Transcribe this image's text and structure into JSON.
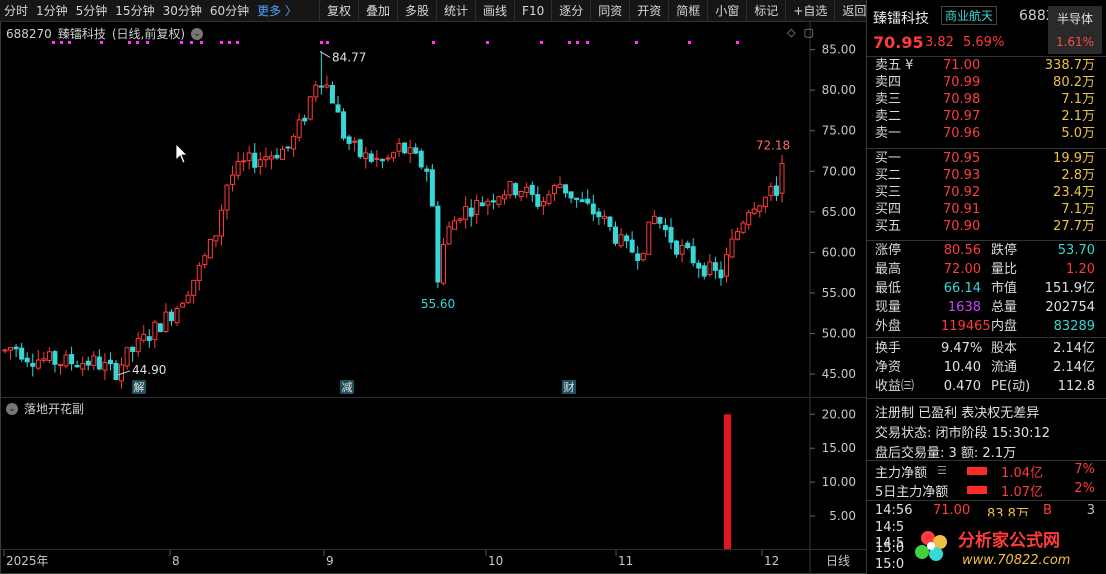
{
  "toolbar": {
    "periods": [
      "分时",
      "1分钟",
      "5分钟",
      "15分钟",
      "30分钟",
      "60分钟"
    ],
    "more": "更多 〉",
    "buttons": [
      "复权",
      "叠加",
      "多股",
      "统计",
      "画线",
      "F10",
      "逐分",
      "同资",
      "开资",
      "简框",
      "小窗",
      "标记",
      "+自选",
      "返回"
    ]
  },
  "chart": {
    "title_code": "688270",
    "title_name": "臻镭科技",
    "title_mode": "(日线,前复权)",
    "sub_title": "落地开花副",
    "period_label": "日线",
    "colors": {
      "up": "#ff3b3b",
      "down": "#35d7d7",
      "grid": "#2a2a2a",
      "dot": "#ff33ff",
      "bar": "#e8141c"
    }
  },
  "chart_data": {
    "type": "candlestick",
    "price_axis": {
      "ticks": [
        85.0,
        80.0,
        75.0,
        70.0,
        65.0,
        60.0,
        55.0,
        50.0,
        45.0
      ],
      "ylim": [
        42.3,
        88.4
      ]
    },
    "indicator_axis": {
      "ticks": [
        20.0,
        15.0,
        10.0,
        5.0
      ],
      "ylim": [
        0,
        22.4
      ]
    },
    "time_axis": {
      "labels": [
        "2025年",
        "8",
        "9",
        "10",
        "11",
        "12"
      ]
    },
    "annotations": {
      "high": "84.77",
      "low": "44.90",
      "low2": "55.60",
      "recent_high": "72.18"
    },
    "events": [
      "解",
      "减",
      "财"
    ],
    "indicator_spike": 20.0
  },
  "panel": {
    "name": "臻镭科技",
    "tag": "商业航天",
    "code": "688270",
    "sector_name": "半导体",
    "sector_pct": "1.61%",
    "price": "70.95",
    "change": "3.82",
    "change_pct": "5.69%",
    "asks": [
      {
        "label": "卖五 ¥",
        "price": "71.00",
        "vol": "338.7万"
      },
      {
        "label": "卖四",
        "price": "70.99",
        "vol": "80.2万"
      },
      {
        "label": "卖三",
        "price": "70.98",
        "vol": "7.1万"
      },
      {
        "label": "卖二",
        "price": "70.97",
        "vol": "2.1万"
      },
      {
        "label": "卖一",
        "price": "70.96",
        "vol": "5.0万"
      }
    ],
    "bids": [
      {
        "label": "买一",
        "price": "70.95",
        "vol": "19.9万"
      },
      {
        "label": "买二",
        "price": "70.93",
        "vol": "2.8万"
      },
      {
        "label": "买三",
        "price": "70.92",
        "vol": "23.4万"
      },
      {
        "label": "买四",
        "price": "70.91",
        "vol": "7.1万"
      },
      {
        "label": "买五",
        "price": "70.90",
        "vol": "27.7万"
      }
    ],
    "stats": [
      {
        "l1": "涨停",
        "v1": "80.56",
        "c1": "#ff3b3b",
        "l2": "跌停",
        "v2": "53.70",
        "c2": "#35d7d7"
      },
      {
        "l1": "最高",
        "v1": "72.00",
        "c1": "#ff3b3b",
        "l2": "量比",
        "v2": "1.20",
        "c2": "#ff3b3b"
      },
      {
        "l1": "最低",
        "v1": "66.14",
        "c1": "#35d7d7",
        "l2": "市值",
        "v2": "151.9亿",
        "c2": "#e0e0e0"
      },
      {
        "l1": "现量",
        "v1": "1638",
        "c1": "#d040ff",
        "l2": "总量",
        "v2": "202754",
        "c2": "#e0e0e0"
      },
      {
        "l1": "外盘",
        "v1": "119465",
        "c1": "#ff3b3b",
        "l2": "内盘",
        "v2": "83289",
        "c2": "#35d7d7"
      }
    ],
    "stats2": [
      {
        "l1": "换手",
        "v1": "9.47%",
        "c1": "#e0e0e0",
        "l2": "股本",
        "v2": "2.14亿",
        "c2": "#e0e0e0"
      },
      {
        "l1": "净资",
        "v1": "10.40",
        "c1": "#e0e0e0",
        "l2": "流通",
        "v2": "2.14亿",
        "c2": "#e0e0e0"
      },
      {
        "l1": "收益㈢",
        "v1": "0.470",
        "c1": "#e0e0e0",
        "l2": "PE(动)",
        "v2": "112.8",
        "c2": "#e0e0e0"
      }
    ],
    "notes": {
      "reg": "注册制 已盈利 表决权无差异",
      "status": "交易状态: 闭市阶段 15:30:12",
      "after": "盘后交易量: 3  额: 2.1万"
    },
    "flows": [
      {
        "label": "主力净额",
        "value": "1.04亿",
        "pct": "7%"
      },
      {
        "label": "5日主力净额",
        "value": "1.07亿",
        "pct": "2%"
      }
    ],
    "tick": {
      "time": "14:56",
      "price": "71.00",
      "vol": "83.8万",
      "side": "B",
      "count": "3"
    },
    "tick_more": [
      "14:5",
      "14:5",
      "15:0",
      "15:0"
    ],
    "watermark": {
      "title": "分析家公式网",
      "url": "www.70822.com"
    }
  }
}
